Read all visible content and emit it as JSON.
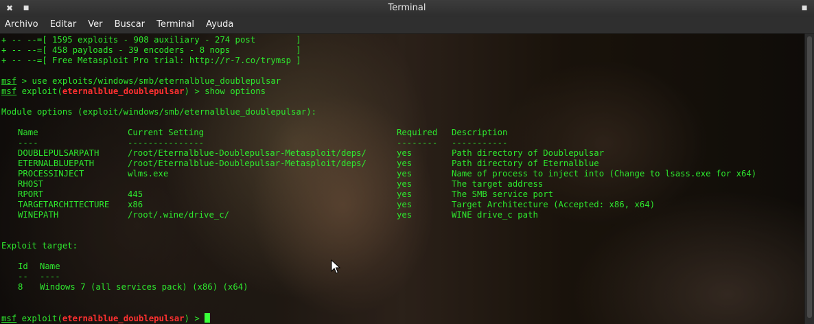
{
  "window": {
    "title": "Terminal",
    "close_glyph": "✖",
    "minimize_glyph": "■",
    "maximize_glyph": "■"
  },
  "menu": [
    "Archivo",
    "Editar",
    "Ver",
    "Buscar",
    "Terminal",
    "Ayuda"
  ],
  "banner": [
    "+ -- --=[ 1595 exploits - 908 auxiliary - 274 post        ]",
    "+ -- --=[ 458 payloads - 39 encoders - 8 nops             ]",
    "+ -- --=[ Free Metasploit Pro trial: http://r-7.co/trymsp ]"
  ],
  "prompt": {
    "msf": "msf",
    "arrow": " > ",
    "exploit_prefix": " exploit(",
    "module": "eternalblue_doublepulsar",
    "exploit_suffix": ")",
    "use_command": "use exploits/windows/smb/eternalblue_doublepulsar",
    "show_command": "show options"
  },
  "module_options_header": "Module options (exploit/windows/smb/eternalblue_doublepulsar):",
  "options_table": {
    "columns": [
      "Name",
      "Current Setting",
      "Required",
      "Description"
    ],
    "underlines": [
      "----",
      "---------------",
      "--------",
      "-----------"
    ],
    "rows": [
      [
        "DOUBLEPULSARPATH",
        "/root/Eternalblue-Doublepulsar-Metasploit/deps/",
        "yes",
        "Path directory of Doublepulsar"
      ],
      [
        "ETERNALBLUEPATH",
        "/root/Eternalblue-Doublepulsar-Metasploit/deps/",
        "yes",
        "Path directory of Eternalblue"
      ],
      [
        "PROCESSINJECT",
        "wlms.exe",
        "yes",
        "Name of process to inject into (Change to lsass.exe for x64)"
      ],
      [
        "RHOST",
        "",
        "yes",
        "The target address"
      ],
      [
        "RPORT",
        "445",
        "yes",
        "The SMB service port"
      ],
      [
        "TARGETARCHITECTURE",
        "x86",
        "yes",
        "Target Architecture (Accepted: x86, x64)"
      ],
      [
        "WINEPATH",
        "/root/.wine/drive_c/",
        "yes",
        "WINE drive_c path"
      ]
    ]
  },
  "exploit_target_header": "Exploit target:",
  "target_table": {
    "columns": [
      "Id",
      "Name"
    ],
    "underlines": [
      "--",
      "----"
    ],
    "rows": [
      [
        "8",
        "Windows 7 (all services pack) (x86) (x64)"
      ]
    ]
  },
  "colors": {
    "terminal_text": "#2ee82e",
    "module_highlight": "#ff3030",
    "cursor": "#39ff39"
  }
}
